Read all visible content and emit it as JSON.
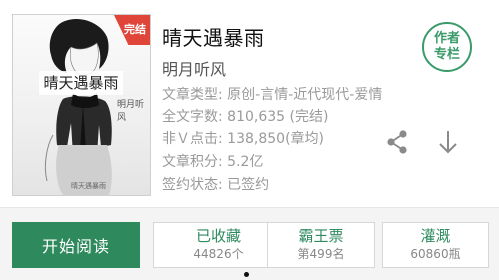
{
  "book": {
    "badge": "完结",
    "cover_title": "晴天遇暴雨",
    "cover_author": "明月听风",
    "cover_small": "晴天遇暴雨",
    "title": "晴天遇暴雨",
    "author": "明月听风",
    "meta": [
      {
        "key": "文章类型:",
        "value": "原创-言情-近代现代-爱情"
      },
      {
        "key": "全文字数:",
        "value": "810,635 (完结)"
      },
      {
        "key": "非Ｖ点击:",
        "value": "138,850(章均)"
      },
      {
        "key": "文章积分:",
        "value": "5.2亿"
      },
      {
        "key": "签约状态:",
        "value": "已签约"
      }
    ]
  },
  "author_column": {
    "line1": "作者",
    "line2": "专栏"
  },
  "icons": {
    "share": "share-icon",
    "download": "arrow-down-icon"
  },
  "actions": {
    "read_label": "开始阅读",
    "collect": {
      "label": "已收藏",
      "count": "44826个"
    },
    "vote": {
      "label": "霸王票",
      "count": "第499名"
    },
    "water": {
      "label": "灌溉",
      "count": "60860瓶"
    }
  },
  "colors": {
    "accent": "#2e8a5d",
    "badge": "#e0453a"
  }
}
